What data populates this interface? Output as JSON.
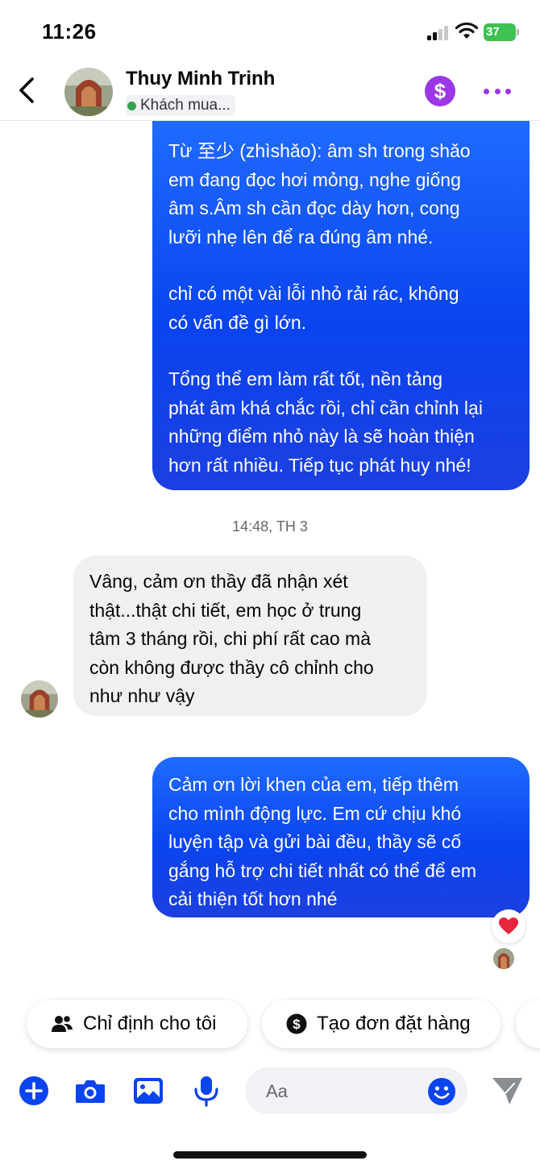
{
  "status_bar": {
    "time": "11:26",
    "battery": "37"
  },
  "header": {
    "contact_name": "Thuy Minh Trinh",
    "contact_status": "Khách mua..."
  },
  "messages": {
    "first_outgoing": [
      "Từ 至少 (zhìshǎo): âm sh trong shǎo\nem đang đọc hơi mỏng, nghe giống\nâm s.Âm sh cần đọc dày hơn, cong\nlưỡi nhẹ lên để ra đúng âm nhé.",
      "chỉ có một vài lỗi nhỏ rải rác, không\ncó vấn đề gì lớn.",
      "Tổng thể em làm rất tốt, nền tảng\nphát âm khá chắc rồi, chỉ cần chỉnh lại\nnhững điểm nhỏ này là sẽ hoàn thiện\nhơn rất nhiều. Tiếp tục phát huy nhé!"
    ],
    "timestamp": "14:48, TH 3",
    "incoming": "Vâng, cảm ơn thầy đã nhận xét\nthật...thật chi tiết, em học ở trung\ntâm 3 tháng rồi, chi phí rất cao mà\ncòn không được thầy cô chỉnh cho\nnhư như vậy",
    "second_outgoing": "Cảm ơn lời khen của em, tiếp thêm\ncho mình động lực. Em cứ chịu khó\nluyện tập và gửi bài đều, thầy sẽ cố\ngắng hỗ trợ chi tiết nhất có thể để em\ncải thiện tốt hơn nhé",
    "reaction": "heart-icon"
  },
  "quick_actions": {
    "assign_label": "Chỉ định cho tôi",
    "create_order_label": "Tạo đơn đặt hàng"
  },
  "composer": {
    "placeholder": "Aa"
  },
  "colors": {
    "accent_blue": "#0a44ef",
    "purple": "#9b37e6",
    "online_green": "#31a24c",
    "heart_red": "#e8253b"
  }
}
